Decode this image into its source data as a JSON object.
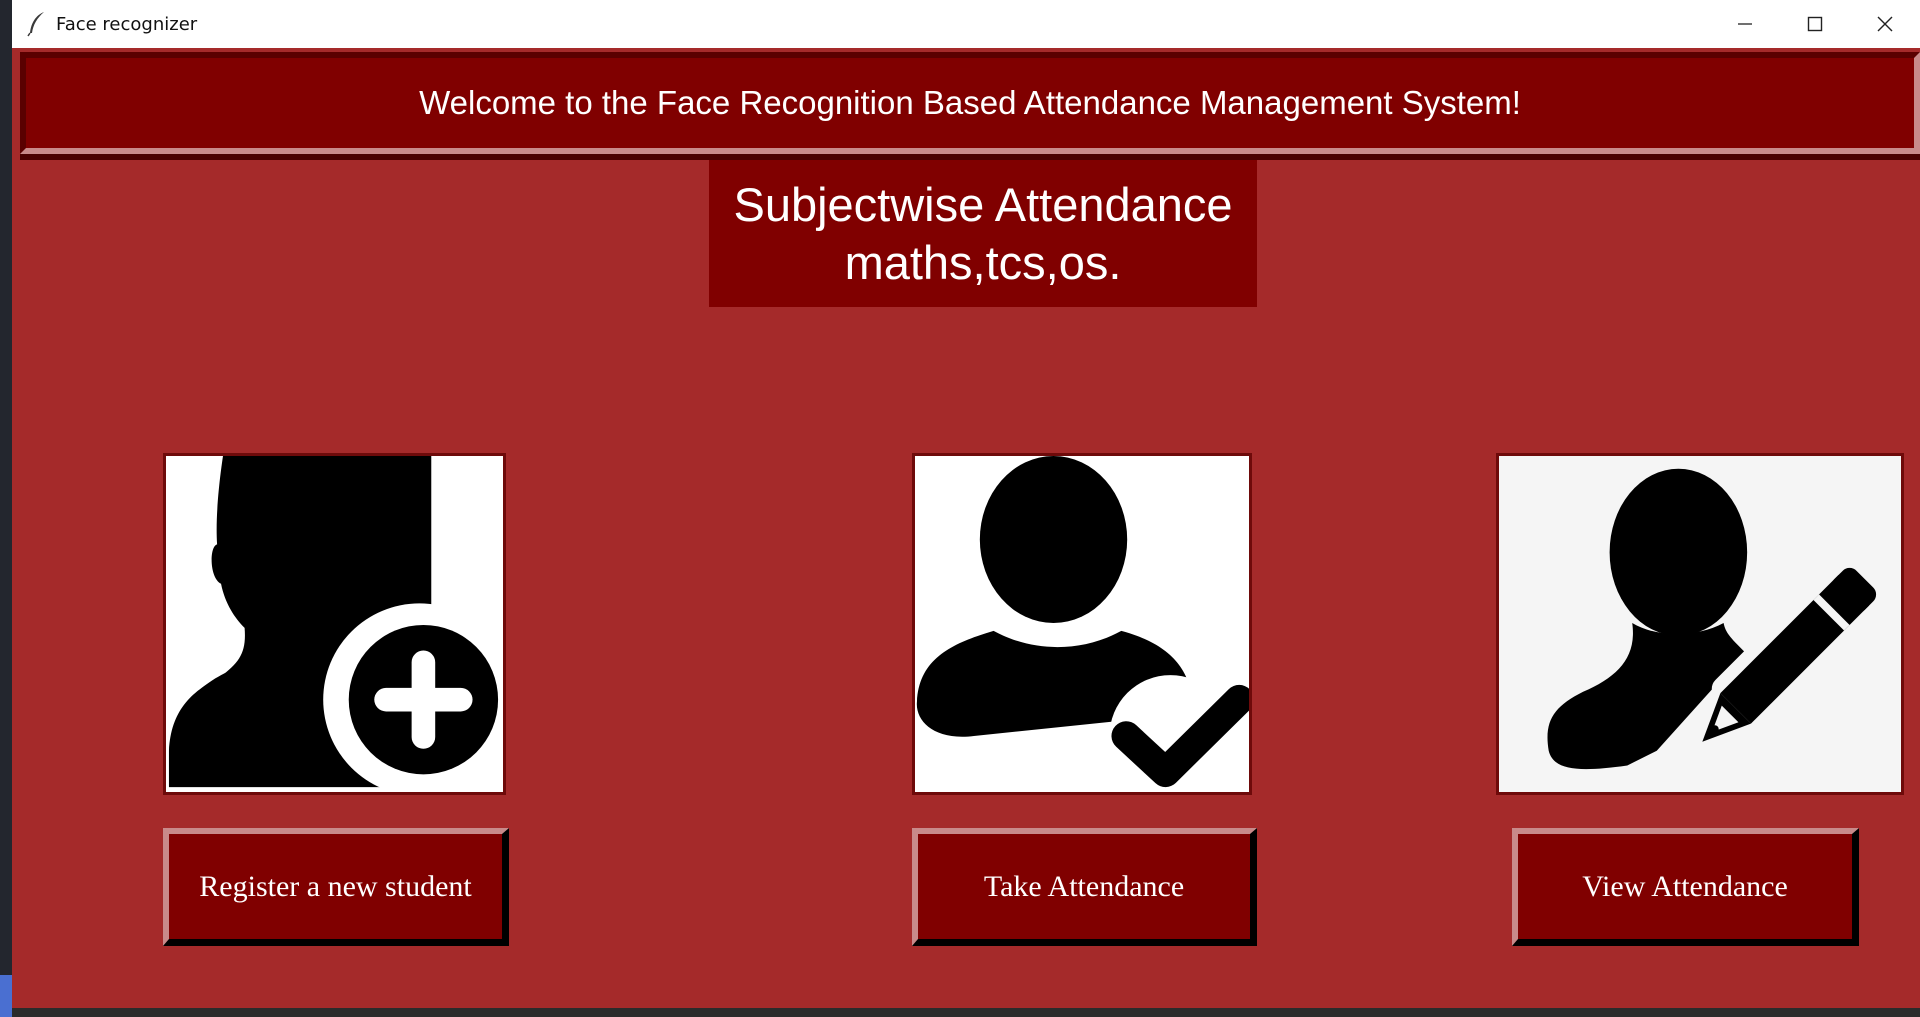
{
  "window": {
    "title": "Face recognizer",
    "app_icon": "feather-icon",
    "controls": [
      "minimize-icon",
      "maximize-icon",
      "close-icon"
    ]
  },
  "banner": {
    "text": "Welcome to the Face Recognition Based Attendance Management System!"
  },
  "subject": {
    "line1": "Subjectwise Attendance",
    "line2": "maths,tcs,os."
  },
  "actions": [
    {
      "icon": "add-user-icon",
      "label": "Register a new student"
    },
    {
      "icon": "user-check-icon",
      "label": "Take Attendance"
    },
    {
      "icon": "user-edit-icon",
      "label": "View Attendance"
    }
  ],
  "colors": {
    "background": "#a52a2a",
    "panel": "#800000",
    "text": "#ffffff"
  }
}
